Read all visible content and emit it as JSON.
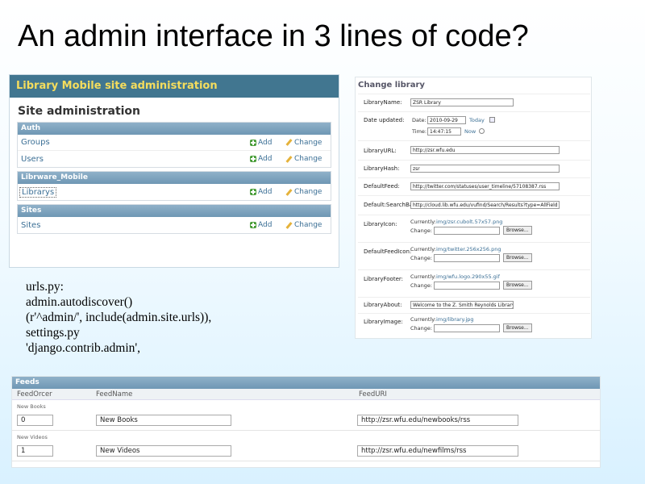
{
  "slide": {
    "title": "An admin interface in 3 lines of code?"
  },
  "admin": {
    "site_header": "Library Mobile site administration",
    "page_title": "Site administration",
    "modules": [
      {
        "caption": "Auth",
        "models": [
          "Groups",
          "Users"
        ]
      },
      {
        "caption": "Librware_Mobile",
        "models": [
          "Librarys"
        ]
      },
      {
        "caption": "Sites",
        "models": [
          "Sites"
        ]
      }
    ],
    "add_label": "Add",
    "change_label": "Change"
  },
  "code": {
    "lines": [
      "urls.py:",
      "admin.autodiscover()",
      "(r'^admin/', include(admin.site.urls)),",
      "settings.py",
      "'django.contrib.admin',"
    ]
  },
  "change_form": {
    "title": "Change library",
    "fields": {
      "name_label": "LibraryName:",
      "name_value": "ZSR Library",
      "date_updated_label": "Date updated:",
      "date_label": "Date:",
      "date_value": "2010-09-29",
      "today_link": "Today",
      "time_label": "Time:",
      "time_value": "14:47:15",
      "now_link": "Now",
      "url_label": "LibraryURL:",
      "url_value": "http://zsr.wfu.edu",
      "hash_label": "LibraryHash:",
      "hash_value": "zsr",
      "feed_label": "DefaultFeed:",
      "feed_value": "http://twitter.com/statuses/user_timeline/57108387.rss",
      "search_label": "Default:SearchBas",
      "search_value": "http://cloud.lib.wfu.edu/vufind/Search/Results?type=AllField",
      "icon_label": "LibraryIcon:",
      "icon_current": "img/zsr.cubolt.57x57.png",
      "feedicon_label": "DefaultFeedIcon:",
      "feedicon_current": "img/twitter.256x256.png",
      "footer_label": "LibraryFooter:",
      "footer_current": "img/wfu.logo.290x55.gif",
      "about_label": "LibraryAbout:",
      "about_value": "Welcome to the Z. Smith Reynolds Library",
      "image_label": "LibraryImage:",
      "image_current": "img/library.jpg",
      "currently": "Currently:",
      "change": "Change:",
      "browse": "Browse..."
    }
  },
  "feeds": {
    "caption": "Feeds",
    "columns": [
      "FeedOrcer",
      "FeedName",
      "FeedURI"
    ],
    "rows": [
      {
        "group": "New Books",
        "order": "0",
        "name": "New Books",
        "uri": "http://zsr.wfu.edu/newbooks/rss"
      },
      {
        "group": "New Videos",
        "order": "1",
        "name": "New Videos",
        "uri": "http://zsr.wfu.edu/newfilms/rss"
      }
    ]
  }
}
